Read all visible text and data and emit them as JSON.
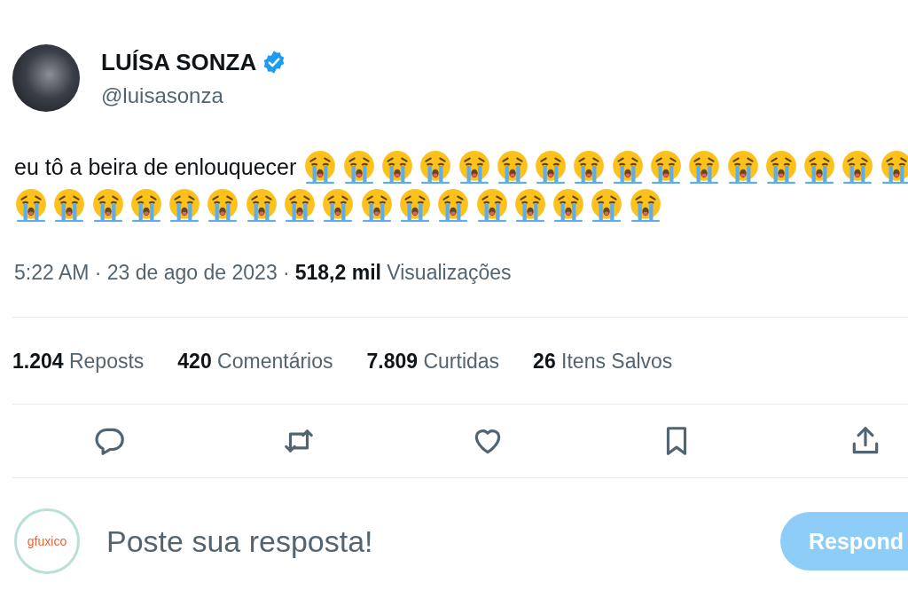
{
  "author": {
    "name": "LUÍSA SONZA",
    "verified": true,
    "handle": "@luisasonza"
  },
  "tweet": {
    "text": "eu tô a beira de enlouquecer",
    "emojis": [
      {
        "kind": "loudly-crying"
      },
      {
        "kind": "loudly-crying"
      },
      {
        "kind": "loudly-crying"
      },
      {
        "kind": "loudly-crying"
      },
      {
        "kind": "loudly-crying"
      },
      {
        "kind": "loudly-crying"
      },
      {
        "kind": "loudly-crying"
      },
      {
        "kind": "loudly-crying"
      },
      {
        "kind": "loudly-crying"
      },
      {
        "kind": "loudly-crying"
      },
      {
        "kind": "loudly-crying"
      },
      {
        "kind": "loudly-crying"
      },
      {
        "kind": "loudly-crying"
      },
      {
        "kind": "loudly-crying"
      },
      {
        "kind": "loudly-crying"
      },
      {
        "kind": "loudly-crying"
      },
      {
        "kind": "loudly-crying"
      },
      {
        "kind": "loudly-crying"
      },
      {
        "kind": "loudly-crying"
      },
      {
        "kind": "loudly-crying"
      },
      {
        "kind": "loudly-crying"
      },
      {
        "kind": "loudly-crying"
      },
      {
        "kind": "loudly-crying"
      },
      {
        "kind": "loudly-crying"
      },
      {
        "kind": "loudly-crying"
      },
      {
        "kind": "loudly-crying"
      },
      {
        "kind": "loudly-crying"
      },
      {
        "kind": "loudly-crying"
      },
      {
        "kind": "loudly-crying"
      },
      {
        "kind": "loudly-crying"
      },
      {
        "kind": "loudly-crying"
      },
      {
        "kind": "loudly-crying"
      },
      {
        "kind": "loudly-crying"
      }
    ]
  },
  "meta": {
    "time": "5:22 AM · 23 de ago de 2023 ·",
    "views_count": "518,2 mil",
    "views_label": "Visualizações"
  },
  "stats": [
    {
      "count": "1.204",
      "label": "Reposts"
    },
    {
      "count": "420",
      "label": "Comentários"
    },
    {
      "count": "7.809",
      "label": "Curtidas"
    },
    {
      "count": "26",
      "label": "Itens Salvos"
    }
  ],
  "actions": [
    {
      "kind": "reply"
    },
    {
      "kind": "repost"
    },
    {
      "kind": "like"
    },
    {
      "kind": "bookmark"
    },
    {
      "kind": "share"
    }
  ],
  "reply": {
    "avatar_logo": "gfuxico",
    "placeholder": "Poste sua resposta!",
    "button": "Respond",
    "button_disabled": true
  }
}
